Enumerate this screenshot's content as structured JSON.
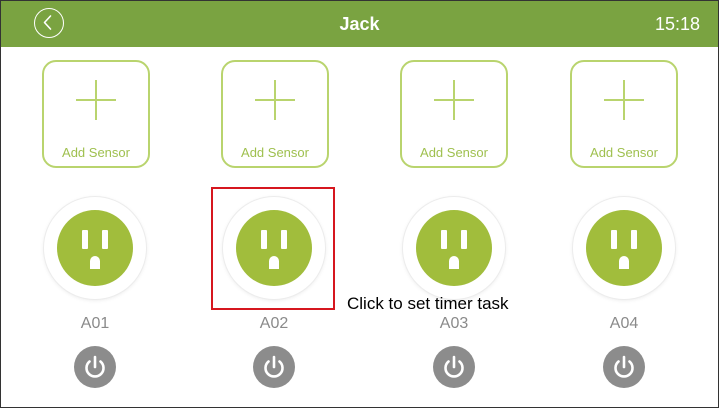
{
  "header": {
    "title": "Jack",
    "time": "15:18",
    "back_icon": "chevron-left-icon",
    "color": "#7aa341"
  },
  "sensors": [
    {
      "label": "Add Sensor",
      "icon": "plus-icon"
    },
    {
      "label": "Add Sensor",
      "icon": "plus-icon"
    },
    {
      "label": "Add Sensor",
      "icon": "plus-icon"
    },
    {
      "label": "Add Sensor",
      "icon": "plus-icon"
    }
  ],
  "outlets": [
    {
      "name": "A01",
      "icon": "outlet-icon",
      "power_icon": "power-icon"
    },
    {
      "name": "A02",
      "icon": "outlet-icon",
      "power_icon": "power-icon"
    },
    {
      "name": "A03",
      "icon": "outlet-icon",
      "power_icon": "power-icon"
    },
    {
      "name": "A04",
      "icon": "outlet-icon",
      "power_icon": "power-icon"
    }
  ],
  "annotation": {
    "text": "Click to set timer task",
    "highlight_color": "#d6171f"
  },
  "colors": {
    "accent": "#7aa341",
    "outlet_green": "#a1bd3c",
    "sensor_green": "#b9d46e",
    "power_gray": "#8c8c8c"
  }
}
